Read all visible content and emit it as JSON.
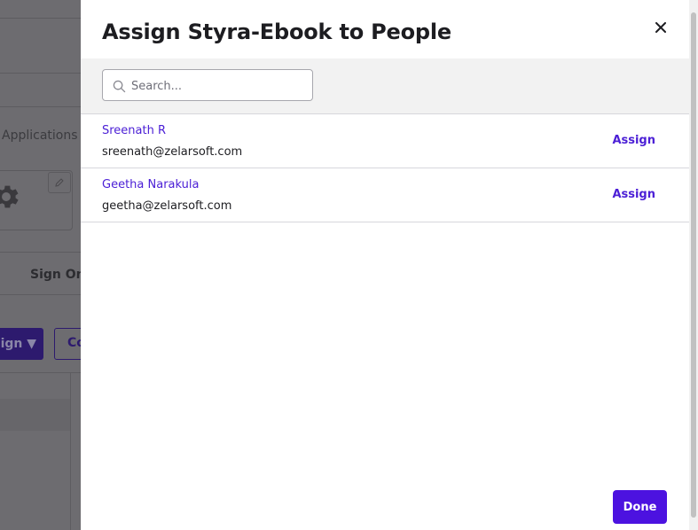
{
  "background": {
    "nav_label": "Applications",
    "tab_label": "Sign On",
    "assign_button": "ign ▼",
    "convert_button": "Co"
  },
  "dialog": {
    "title": "Assign Styra-Ebook to People",
    "search": {
      "placeholder": "Search...",
      "value": ""
    },
    "people": [
      {
        "name": "Sreenath R",
        "email": "sreenath@zelarsoft.com",
        "action": "Assign"
      },
      {
        "name": "Geetha Narakula",
        "email": "geetha@zelarsoft.com",
        "action": "Assign"
      }
    ],
    "done_label": "Done"
  },
  "colors": {
    "accent": "#4c12e0",
    "link": "#4c20d6",
    "text": "#1d1d21"
  },
  "icons": {
    "close": "close-icon",
    "search": "search-icon",
    "gear": "gear-icon",
    "pencil": "pencil-icon"
  }
}
